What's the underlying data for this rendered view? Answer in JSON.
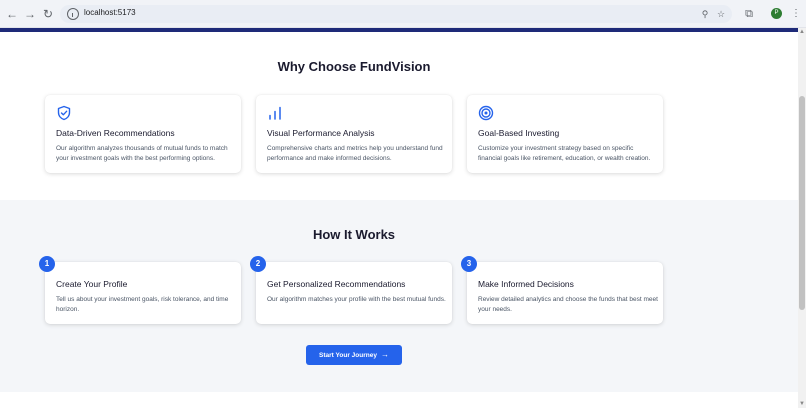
{
  "browser": {
    "url": "localhost:5173",
    "profile_initial": "P"
  },
  "why": {
    "title": "Why Choose FundVision",
    "cards": [
      {
        "icon": "shield-check-icon",
        "title": "Data-Driven Recommendations",
        "desc": "Our algorithm analyzes thousands of mutual funds to match your investment goals with the best performing options."
      },
      {
        "icon": "bar-chart-icon",
        "title": "Visual Performance Analysis",
        "desc": "Comprehensive charts and metrics help you understand fund performance and make informed decisions."
      },
      {
        "icon": "target-icon",
        "title": "Goal-Based Investing",
        "desc": "Customize your investment strategy based on specific financial goals like retirement, education, or wealth creation."
      }
    ]
  },
  "how": {
    "title": "How It Works",
    "steps": [
      {
        "number": "1",
        "title": "Create Your Profile",
        "desc": "Tell us about your investment goals, risk tolerance, and time horizon."
      },
      {
        "number": "2",
        "title": "Get Personalized Recommendations",
        "desc": "Our algorithm matches your profile with the best mutual funds."
      },
      {
        "number": "3",
        "title": "Make Informed Decisions",
        "desc": "Review detailed analytics and choose the funds that best meet your needs."
      }
    ],
    "cta_label": "Start Your Journey"
  },
  "colors": {
    "accent": "#2563eb",
    "navy": "#1e2a78",
    "section_bg": "#f4f6f9"
  }
}
